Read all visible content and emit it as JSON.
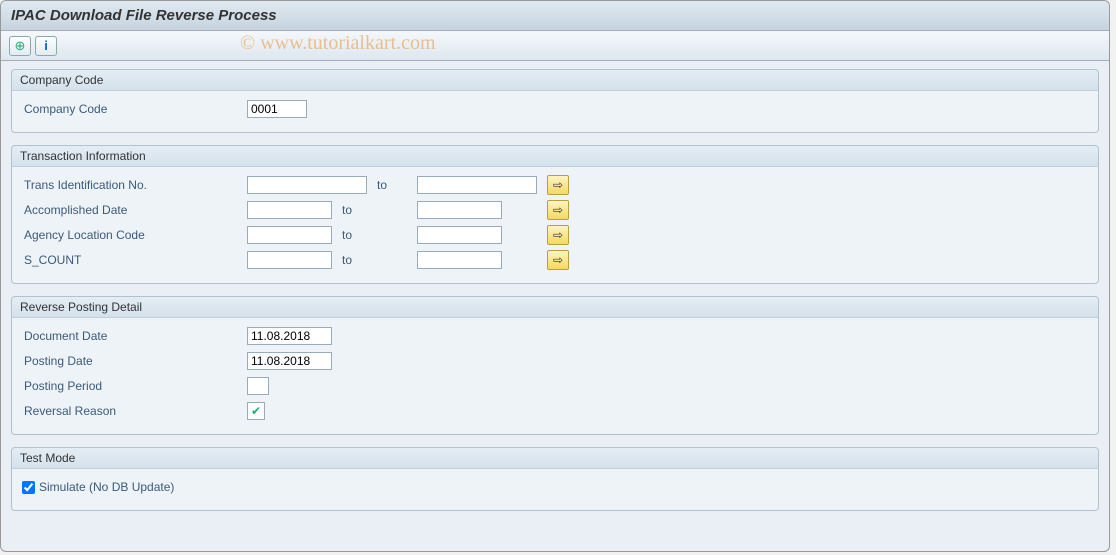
{
  "title": "IPAC Download File Reverse Process",
  "watermark": "© www.tutorialkart.com",
  "groups": {
    "company": {
      "header": "Company Code",
      "fields": {
        "company_code": {
          "label": "Company Code",
          "value": "0001"
        }
      }
    },
    "trans": {
      "header": "Transaction Information",
      "to": "to",
      "fields": {
        "trans_id": {
          "label": "Trans Identification No.",
          "from": "",
          "to_val": ""
        },
        "acc_date": {
          "label": "Accomplished Date",
          "from": "",
          "to_val": ""
        },
        "agency": {
          "label": "Agency Location Code",
          "from": "",
          "to_val": ""
        },
        "s_count": {
          "label": "S_COUNT",
          "from": "",
          "to_val": ""
        }
      }
    },
    "reverse": {
      "header": "Reverse Posting Detail",
      "fields": {
        "doc_date": {
          "label": "Document Date",
          "value": "11.08.2018"
        },
        "post_date": {
          "label": "Posting Date",
          "value": "11.08.2018"
        },
        "period": {
          "label": "Posting Period",
          "value": ""
        },
        "reason": {
          "label": "Reversal Reason",
          "value": ""
        }
      }
    },
    "test": {
      "header": "Test Mode",
      "fields": {
        "simulate": {
          "label": "Simulate (No DB Update)",
          "checked": true
        }
      }
    }
  }
}
